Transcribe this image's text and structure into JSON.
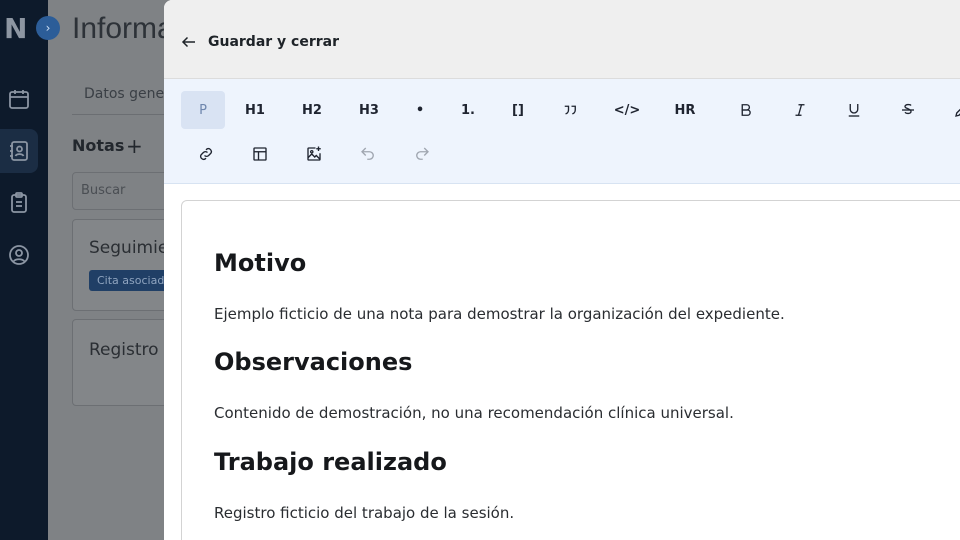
{
  "background": {
    "logo": "N",
    "title": "Informa",
    "tab_label": "Datos genera",
    "notes_heading": "Notas",
    "add_symbol": "+",
    "search_placeholder": "Buscar",
    "cards": [
      {
        "title": "Seguimie",
        "badge": "Cita asociada"
      },
      {
        "title": "Registro",
        "badge": ""
      }
    ]
  },
  "header": {
    "back_label": "Guardar y cerrar"
  },
  "toolbar": {
    "row1": [
      {
        "name": "paragraph",
        "label": "P",
        "icon": "",
        "active": true
      },
      {
        "name": "heading-1",
        "label": "H1",
        "icon": ""
      },
      {
        "name": "heading-2",
        "label": "H2",
        "icon": ""
      },
      {
        "name": "heading-3",
        "label": "H3",
        "icon": ""
      },
      {
        "name": "bullet-list",
        "label": "•",
        "icon": ""
      },
      {
        "name": "ordered-list",
        "label": "1.",
        "icon": ""
      },
      {
        "name": "task-list",
        "label": "[]",
        "icon": ""
      },
      {
        "name": "blockquote",
        "label": "",
        "icon": "quote-icon"
      },
      {
        "name": "code-block",
        "label": "</>",
        "icon": ""
      },
      {
        "name": "horizontal-rule",
        "label": "HR",
        "icon": ""
      },
      {
        "name": "bold",
        "label": "",
        "icon": "bold-icon"
      },
      {
        "name": "italic",
        "label": "",
        "icon": "italic-icon"
      },
      {
        "name": "underline",
        "label": "",
        "icon": "underline-icon"
      },
      {
        "name": "strikethrough",
        "label": "",
        "icon": "strikethrough-icon"
      },
      {
        "name": "highlight",
        "label": "",
        "icon": "pen-icon"
      }
    ],
    "row2": [
      {
        "name": "link",
        "icon": "link-icon"
      },
      {
        "name": "table",
        "icon": "table-icon"
      },
      {
        "name": "image",
        "icon": "image-plus-icon"
      },
      {
        "name": "undo",
        "icon": "undo-icon",
        "disabled": true
      },
      {
        "name": "redo",
        "icon": "redo-icon",
        "disabled": true
      }
    ]
  },
  "document": {
    "sections": [
      {
        "heading": "Motivo",
        "body": "Ejemplo ficticio de una nota para demostrar la organización del expediente."
      },
      {
        "heading": "Observaciones",
        "body": "Contenido de demostración, no una recomendación clínica universal."
      },
      {
        "heading": "Trabajo realizado",
        "body": "Registro ficticio del trabajo de la sesión."
      }
    ]
  }
}
